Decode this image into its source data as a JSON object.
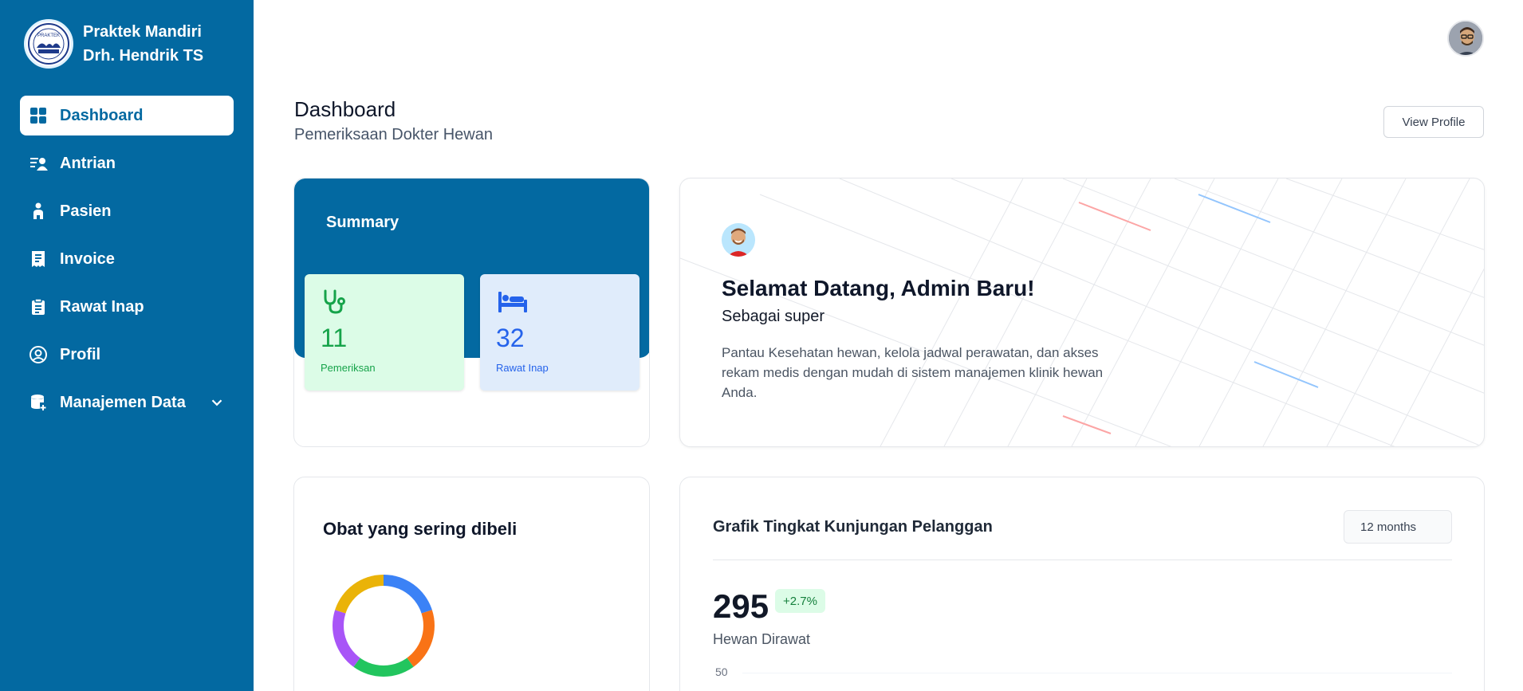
{
  "brand": {
    "line1": "Praktek Mandiri",
    "line2": "Drh. Hendrik TS",
    "logo_icon": "clinic-logo-icon"
  },
  "sidebar": {
    "items": [
      {
        "label": "Dashboard",
        "icon": "dashboard-grid-icon",
        "active": true
      },
      {
        "label": "Antrian",
        "icon": "queue-list-icon"
      },
      {
        "label": "Pasien",
        "icon": "patient-icon"
      },
      {
        "label": "Invoice",
        "icon": "receipt-icon"
      },
      {
        "label": "Rawat Inap",
        "icon": "clipboard-icon"
      },
      {
        "label": "Profil",
        "icon": "user-circle-icon"
      },
      {
        "label": "Manajemen Data",
        "icon": "database-icon",
        "expandable": true
      }
    ]
  },
  "header": {
    "title": "Dashboard",
    "subtitle": "Pemeriksaan Dokter Hewan",
    "view_profile": "View Profile"
  },
  "summary": {
    "title": "Summary",
    "stats": [
      {
        "value": "11",
        "label": "Pemeriksan",
        "icon": "stethoscope-icon",
        "color": "#16a34a"
      },
      {
        "value": "32",
        "label": "Rawat Inap",
        "icon": "bed-icon",
        "color": "#2563eb"
      }
    ]
  },
  "welcome": {
    "title": "Selamat Datang, Admin Baru!",
    "role": "Sebagai super",
    "description": "Pantau Kesehatan hewan, kelola jadwal perawatan, dan akses rekam medis dengan mudah di sistem manajemen klinik hewan Anda."
  },
  "obat": {
    "title": "Obat yang sering dibeli"
  },
  "grafik": {
    "title": "Grafik Tingkat Kunjungan Pelanggan",
    "period": "12 months",
    "total": "295",
    "growth": "+2.7%",
    "total_label": "Hewan Dirawat",
    "y_tick_top": "50"
  },
  "chart_data": {
    "type": "pie",
    "title": "Obat yang sering dibeli",
    "values": [
      20,
      20,
      20,
      20,
      20
    ],
    "colors": [
      "#3b82f6",
      "#f97316",
      "#22c55e",
      "#a855f7",
      "#eab308"
    ]
  },
  "colors": {
    "primary": "#0369a1",
    "success": "#16a34a",
    "info": "#2563eb"
  }
}
